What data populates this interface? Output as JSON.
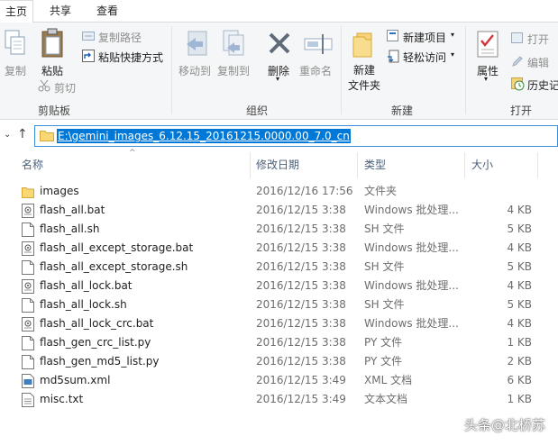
{
  "ribbon_tabs": [
    "主页",
    "共享",
    "查看"
  ],
  "clipboard": {
    "group": "剪贴板",
    "copy": "复制",
    "paste": "粘贴",
    "copy_path": "复制路径",
    "paste_shortcut": "粘贴快捷方式",
    "cut": "剪切"
  },
  "organize": {
    "group": "组织",
    "move_to": "移动到",
    "copy_to": "复制到",
    "delete": "删除",
    "rename": "重命名"
  },
  "new": {
    "group": "新建",
    "new_folder_1": "新建",
    "new_folder_2": "文件夹",
    "new_item": "新建项目",
    "easy_access": "轻松访问"
  },
  "open": {
    "group": "打开",
    "properties": "属性",
    "open": "打开",
    "edit": "编辑",
    "history": "历史记"
  },
  "address": {
    "path": "E:\\gemini_images_6.12.15_20161215.0000.00_7.0_cn"
  },
  "columns": {
    "name": "名称",
    "date": "修改日期",
    "type": "类型",
    "size": "大小"
  },
  "files": [
    {
      "name": "images",
      "date": "2016/12/16 17:56",
      "type": "文件夹",
      "size": "",
      "icon": "folder-icon"
    },
    {
      "name": "flash_all.bat",
      "date": "2016/12/15 3:38",
      "type": "Windows 批处理...",
      "size": "4 KB",
      "icon": "batch-file-icon"
    },
    {
      "name": "flash_all.sh",
      "date": "2016/12/15 3:38",
      "type": "SH 文件",
      "size": "5 KB",
      "icon": "file-icon"
    },
    {
      "name": "flash_all_except_storage.bat",
      "date": "2016/12/15 3:38",
      "type": "Windows 批处理...",
      "size": "4 KB",
      "icon": "batch-file-icon"
    },
    {
      "name": "flash_all_except_storage.sh",
      "date": "2016/12/15 3:38",
      "type": "SH 文件",
      "size": "5 KB",
      "icon": "file-icon"
    },
    {
      "name": "flash_all_lock.bat",
      "date": "2016/12/15 3:38",
      "type": "Windows 批处理...",
      "size": "4 KB",
      "icon": "batch-file-icon"
    },
    {
      "name": "flash_all_lock.sh",
      "date": "2016/12/15 3:38",
      "type": "SH 文件",
      "size": "5 KB",
      "icon": "file-icon"
    },
    {
      "name": "flash_all_lock_crc.bat",
      "date": "2016/12/15 3:38",
      "type": "Windows 批处理...",
      "size": "4 KB",
      "icon": "batch-file-icon"
    },
    {
      "name": "flash_gen_crc_list.py",
      "date": "2016/12/15 3:38",
      "type": "PY 文件",
      "size": "1 KB",
      "icon": "file-icon"
    },
    {
      "name": "flash_gen_md5_list.py",
      "date": "2016/12/15 3:38",
      "type": "PY 文件",
      "size": "2 KB",
      "icon": "file-icon"
    },
    {
      "name": "md5sum.xml",
      "date": "2016/12/15 3:49",
      "type": "XML 文档",
      "size": "6 KB",
      "icon": "xml-file-icon"
    },
    {
      "name": "misc.txt",
      "date": "2016/12/15 3:49",
      "type": "文本文档",
      "size": "1 KB",
      "icon": "text-file-icon"
    }
  ],
  "watermark": "头条@北桥苏",
  "colors": {
    "accent": "#0078d7",
    "folder": "#f8d775",
    "ribbon_bg": "#f5f6f7"
  }
}
